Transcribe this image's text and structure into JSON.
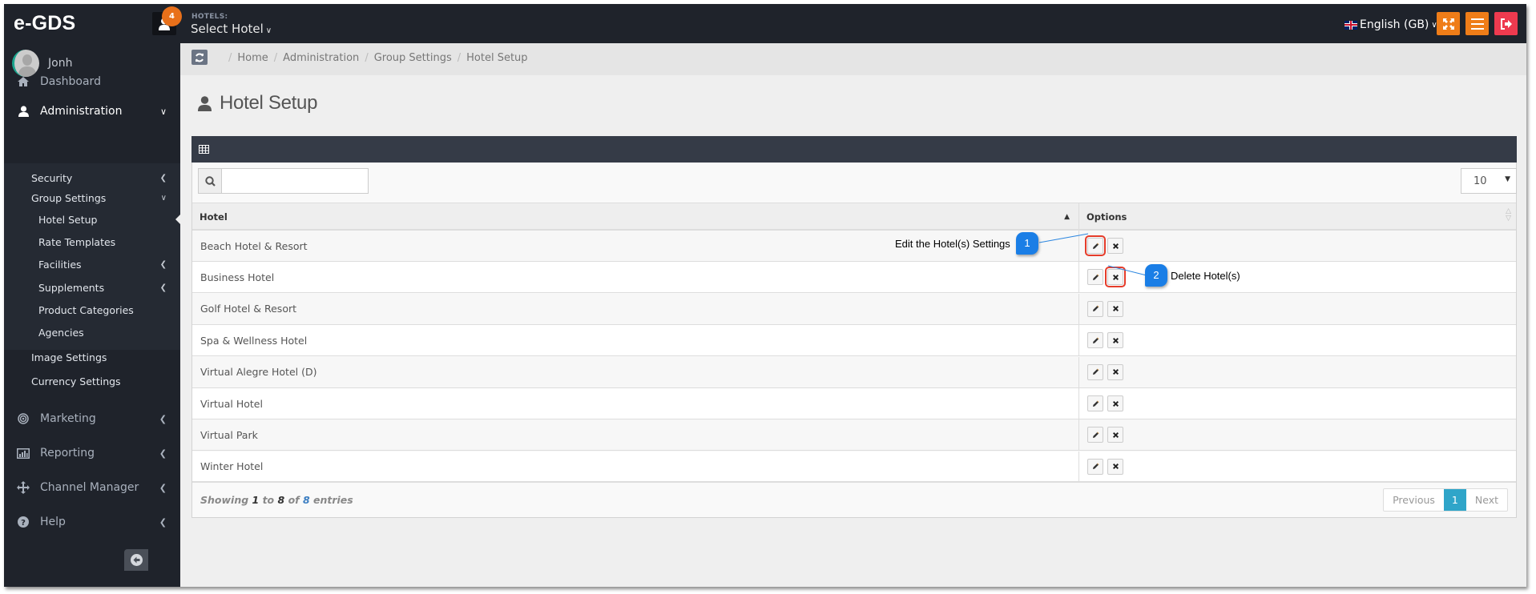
{
  "app": {
    "brand": "e-GDS",
    "notification_count": "4",
    "hotels_label": "HOTELS:",
    "hotel_selector": "Select Hotel",
    "language": "English (GB)"
  },
  "sidebar": {
    "user_name": "Jonh",
    "items": [
      {
        "label": "Dashboard",
        "icon": "home-icon"
      },
      {
        "label": "Administration",
        "icon": "user-icon",
        "expanded": true
      },
      {
        "label": "Marketing",
        "icon": "bullseye-icon"
      },
      {
        "label": "Reporting",
        "icon": "bar-chart-icon"
      },
      {
        "label": "Channel Manager",
        "icon": "move-icon"
      },
      {
        "label": "Help",
        "icon": "question-circle-icon"
      }
    ],
    "admin_sub": [
      {
        "label": "Security"
      },
      {
        "label": "Group Settings",
        "expanded": true
      },
      {
        "label": "Hotel Setup",
        "current": true
      },
      {
        "label": "Rate Templates"
      },
      {
        "label": "Facilities"
      },
      {
        "label": "Supplements"
      },
      {
        "label": "Product Categories"
      },
      {
        "label": "Agencies"
      },
      {
        "label": "Image Settings"
      },
      {
        "label": "Currency Settings"
      }
    ]
  },
  "breadcrumb": [
    "Home",
    "Administration",
    "Group Settings",
    "Hotel Setup"
  ],
  "page": {
    "title": "Hotel Setup"
  },
  "table": {
    "search_value": "",
    "page_size": "10",
    "columns": [
      "Hotel",
      "Options"
    ],
    "sort": {
      "column": "Hotel",
      "direction": "asc"
    },
    "rows": [
      {
        "hotel": "Beach Hotel & Resort"
      },
      {
        "hotel": "Business Hotel"
      },
      {
        "hotel": "Golf Hotel & Resort"
      },
      {
        "hotel": "Spa & Wellness Hotel"
      },
      {
        "hotel": "Virtual Alegre Hotel (D)"
      },
      {
        "hotel": "Virtual Hotel"
      },
      {
        "hotel": "Virtual Park"
      },
      {
        "hotel": "Winter Hotel"
      }
    ],
    "footer": {
      "showing_prefix": "Showing ",
      "from": "1",
      "to_word": " to ",
      "to": "8",
      "of_word": " of ",
      "total": "8",
      "suffix": " entries"
    },
    "pagination": {
      "previous": "Previous",
      "current": "1",
      "next": "Next"
    }
  },
  "annotations": [
    {
      "number": "1",
      "text": "Edit the Hotel(s) Settings"
    },
    {
      "number": "2",
      "text": "Delete Hotel(s)"
    }
  ],
  "colors": {
    "topbar": "#1f232b",
    "accent_orange": "#ef7d18",
    "logout_red": "#ee3a4f",
    "pagination_active": "#2fa5c9",
    "callout_blue": "#1a7ee6",
    "highlight_red": "#e53c2a"
  }
}
